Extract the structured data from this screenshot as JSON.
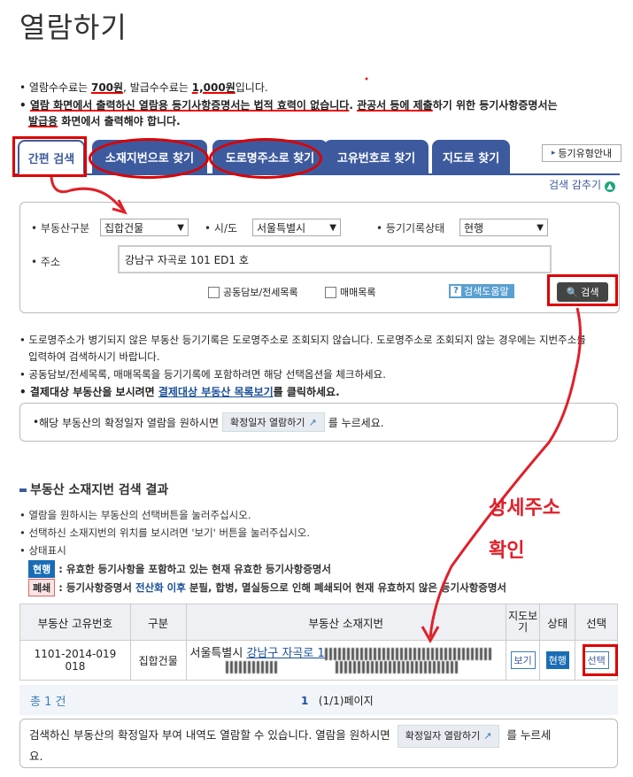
{
  "page": {
    "title": "열람하기"
  },
  "notices": {
    "line1_a": "열람수수료는 ",
    "line1_fee1": "700원",
    "line1_b": ", 발급수수료는 ",
    "line1_fee2": "1,000원",
    "line1_c": "입니다.",
    "line2_a": "열람 화면에서 출력하신 ",
    "line2_b": "열람용 등기사항증명서는 법적 효력이 없습니다",
    "line2_c": ". ",
    "line2_d": "관공서 등에 제출",
    "line2_e": "하기 위한 등기사항증명서는",
    "line3_a": "발급용",
    "line3_b": " 화면에서 출력해야 합니다."
  },
  "tabs": [
    {
      "label": "간편 검색"
    },
    {
      "label": "소재지번으로 찾기"
    },
    {
      "label": "도로명주소로 찾기"
    },
    {
      "label": "고유번호로 찾기"
    },
    {
      "label": "지도로 찾기"
    }
  ],
  "guide_button": "등기유형안내",
  "collapse_label": "검색 감추기",
  "search": {
    "property_type_label": "부동산구분",
    "property_type_value": "집합건물",
    "region_label": "시/도",
    "region_value": "서울특별시",
    "status_label": "등기기록상태",
    "status_value": "현행",
    "address_label": "주소",
    "address_value": "강남구 자곡로 101 ED1 호",
    "check1": "공동담보/전세목록",
    "check2": "매매목록",
    "help_label": "검색도움말",
    "search_button": "검색"
  },
  "info": {
    "line1": "도로명주소가 병기되지 않은 부동산 등기기록은 도로명주소로 조회되지 않습니다. 도로명주소로 조회되지 않는 경우에는 지번주소를",
    "line1_bold": "지번주소를",
    "line2": "입력하여 검색하시기 바랍니다.",
    "line3": "공동담보/전세목록, 매매목록을 등기기록에 포함하려면 해당 선택옵션을 체크하세요.",
    "line4_a": "결제대상 부동산을 보시려면 ",
    "line4_link": "결제대상 부동산 목록보기",
    "line4_b": "를 클릭하세요."
  },
  "confirm_box": {
    "text_a": "해당 부동산의 확정일자 열람을 원하시면",
    "pill": "확정일자 열람하기",
    "text_b": "를 누르세요."
  },
  "results": {
    "section_title": "부동산 소재지번 검색 결과",
    "desc1": "열람을 원하시는 부동산의 선택버튼을 눌러주십시오.",
    "desc2": "선택하신 소재지번의 위치를 보시려면 '보기' 버튼을 눌러주십시오.",
    "desc3": "상태표시",
    "badge_current": "현행",
    "badge_current_desc": ": 유효한 등기사항을 포함하고 있는 현재 유효한 등기사항증명서",
    "badge_closed": "폐쇄",
    "badge_closed_desc_a": ": 등기사항증명서 ",
    "badge_closed_desc_b": "전산화 이후",
    "badge_closed_desc_c": " 분필, 합병, 멸실등으로 인해 폐쇄되어 현재 유효하지 않은 등기사항증명서",
    "headers": [
      "부동산 고유번호",
      "구분",
      "부동산 소재지번",
      "지도보기",
      "상태",
      "선택"
    ],
    "row": {
      "id_line1": "1101-2014-019",
      "id_line2": "018",
      "type": "집합건물",
      "addr_a": "서울특별시 ",
      "addr_link": "강남구 자곡로 1",
      "map_button": "보기",
      "status": "현행",
      "select_button": "선택"
    },
    "total": "총 1 건",
    "page_current": "1",
    "page_info": "(1/1)페이지"
  },
  "bottom_box": {
    "text_a": "검색하신 부동산의 확정일자 부여 내역도 열람할 수 있습니다. 열람을 원하시면",
    "pill": "확정일자 열람하기",
    "text_b": "를 누르세",
    "text_c": "요."
  },
  "annotation": {
    "line1": "상세주소",
    "line2": "확인"
  }
}
